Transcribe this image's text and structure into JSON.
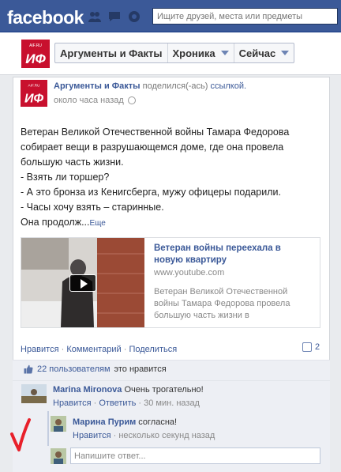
{
  "topbar": {
    "logo": "facebook",
    "search_placeholder": "Ищите друзей, места или предметы",
    "icons": [
      "friend-requests-icon",
      "messages-icon",
      "notifications-icon"
    ]
  },
  "page": {
    "logo_text_top": "AIF.RU",
    "logo_text": "ИФ",
    "tabs": [
      {
        "label": "Аргументы и Факты",
        "dropdown": false
      },
      {
        "label": "Хроника",
        "dropdown": true
      },
      {
        "label": "Сейчас",
        "dropdown": true
      }
    ]
  },
  "post": {
    "author": "Аргументы и Факты",
    "action": "поделился(-ась)",
    "object": "ссылкой.",
    "time": "около часа назад",
    "lines": [
      "Ветеран Великой Отечественной войны Тамара Федорова",
      "собирает вещи в разрушающемся доме, где она провела",
      "большую часть жизни.",
      "- Взять ли торшер?",
      "- А это бронза из Кенигсберга, мужу офицеры подарили.",
      "- Часы хочу взять – старинные.",
      "Она продолж..."
    ],
    "more_label": "Еще",
    "link": {
      "title": "Ветеран войны переехала в новую квартиру",
      "domain": "www.youtube.com",
      "description": "Ветеран Великой Отечественной войны Тамара Федорова провела большую часть жизни в"
    },
    "actions": {
      "like": "Нравится",
      "comment": "Комментарий",
      "share": "Поделиться",
      "separator": "·"
    },
    "comment_count": "2",
    "likes": {
      "count_text": "22 пользователям",
      "suffix": "это нравится"
    }
  },
  "comments": [
    {
      "name": "Marina Mironova",
      "text": "Очень трогательно!",
      "like": "Нравится",
      "reply": "Ответить",
      "time": "30 мин. назад"
    },
    {
      "name": "Марина Пурим",
      "text": "согласна!",
      "like": "Нравится",
      "time": "несколько секунд назад"
    }
  ],
  "reply_placeholder": "Напишите ответ...",
  "colors": {
    "brand": "#3b5998",
    "logo_red": "#c8102e",
    "annotation": "#e8202a"
  }
}
